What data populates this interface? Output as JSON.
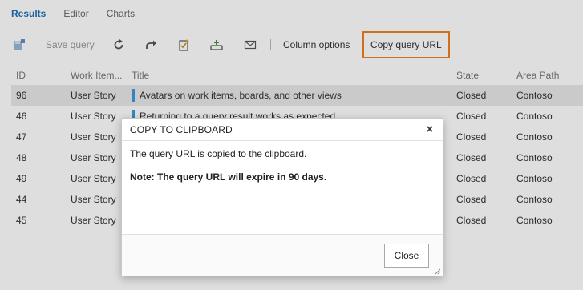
{
  "tabs": [
    {
      "label": "Results"
    },
    {
      "label": "Editor"
    },
    {
      "label": "Charts"
    }
  ],
  "toolbar": {
    "save_query_label": "Save query",
    "column_options_label": "Column options",
    "copy_query_url_label": "Copy query URL",
    "highlight_color": "#f08020"
  },
  "grid": {
    "columns": [
      "ID",
      "Work Item...",
      "Title",
      "State",
      "Area Path"
    ],
    "rows": [
      {
        "id": "96",
        "type": "User Story",
        "title": "Avatars on work items, boards, and other views",
        "state": "Closed",
        "area": "Contoso"
      },
      {
        "id": "46",
        "type": "User Story",
        "title": "Returning to a query result works as expected",
        "state": "Closed",
        "area": "Contoso"
      },
      {
        "id": "47",
        "type": "User Story",
        "title": "",
        "state": "Closed",
        "area": "Contoso"
      },
      {
        "id": "48",
        "type": "User Story",
        "title": "",
        "state": "Closed",
        "area": "Contoso"
      },
      {
        "id": "49",
        "type": "User Story",
        "title": "",
        "state": "Closed",
        "area": "Contoso"
      },
      {
        "id": "44",
        "type": "User Story",
        "title": "",
        "state": "Closed",
        "area": "Contoso"
      },
      {
        "id": "45",
        "type": "User Story",
        "title": "",
        "state": "Closed",
        "area": "Contoso"
      }
    ]
  },
  "dialog": {
    "title": "COPY TO CLIPBOARD",
    "message": "The query URL is copied to the clipboard.",
    "note": "Note: The query URL will expire in 90 days.",
    "close_label": "Close"
  }
}
